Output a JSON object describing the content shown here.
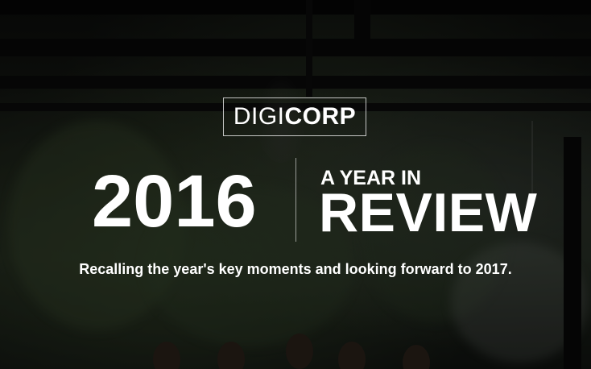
{
  "logo": {
    "prefix": "DIGI",
    "suffix": "CORP"
  },
  "hero": {
    "year": "2016",
    "subtitle_small": "A YEAR IN",
    "subtitle_big": "REVIEW",
    "tagline": "Recalling the year's key moments and looking forward to 2017."
  },
  "background": {
    "description_color": "#0d0f0c",
    "text_color": "#ffffff"
  }
}
